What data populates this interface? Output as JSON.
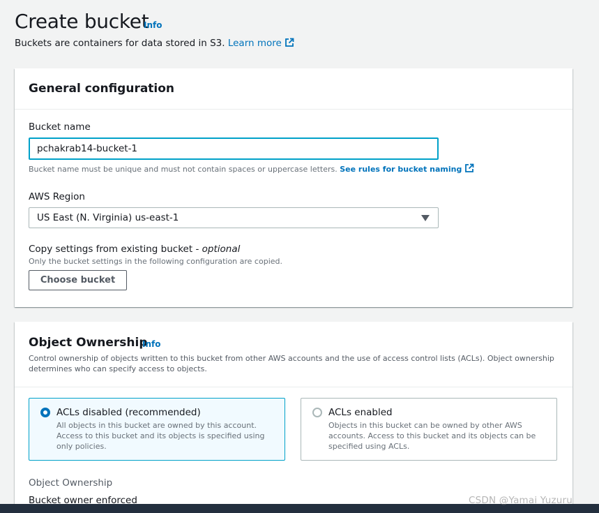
{
  "header": {
    "title": "Create bucket",
    "info": "Info",
    "subtitle": "Buckets are containers for data stored in S3.",
    "learn_more": "Learn more"
  },
  "general": {
    "title": "General configuration",
    "bucket_name_label": "Bucket name",
    "bucket_name_value": "pchakrab14-bucket-1",
    "bucket_name_hint": "Bucket name must be unique and must not contain spaces or uppercase letters.",
    "naming_rules_link": "See rules for bucket naming",
    "region_label": "AWS Region",
    "region_value": "US East (N. Virginia) us-east-1",
    "copy_label": "Copy settings from existing bucket -",
    "copy_optional": "optional",
    "copy_hint": "Only the bucket settings in the following configuration are copied.",
    "choose_bucket_button": "Choose bucket"
  },
  "ownership": {
    "title": "Object Ownership",
    "info": "Info",
    "description": "Control ownership of objects written to this bucket from other AWS accounts and the use of access control lists (ACLs). Object ownership determines who can specify access to objects.",
    "options": [
      {
        "label": "ACLs disabled (recommended)",
        "description": "All objects in this bucket are owned by this account. Access to this bucket and its objects is specified using only policies.",
        "selected": true
      },
      {
        "label": "ACLs enabled",
        "description": "Objects in this bucket can be owned by other AWS accounts. Access to this bucket and its objects can be specified using ACLs.",
        "selected": false
      }
    ],
    "ownership_label": "Object Ownership",
    "ownership_value": "Bucket owner enforced"
  },
  "watermark": "CSDN @Yamai Yuzuru",
  "colors": {
    "link": "#0073bb",
    "focus_border": "#00a1c9",
    "selected_tile_bg": "#f1faff",
    "page_bg": "#f2f3f3",
    "bottom_bar": "#232f3e"
  }
}
